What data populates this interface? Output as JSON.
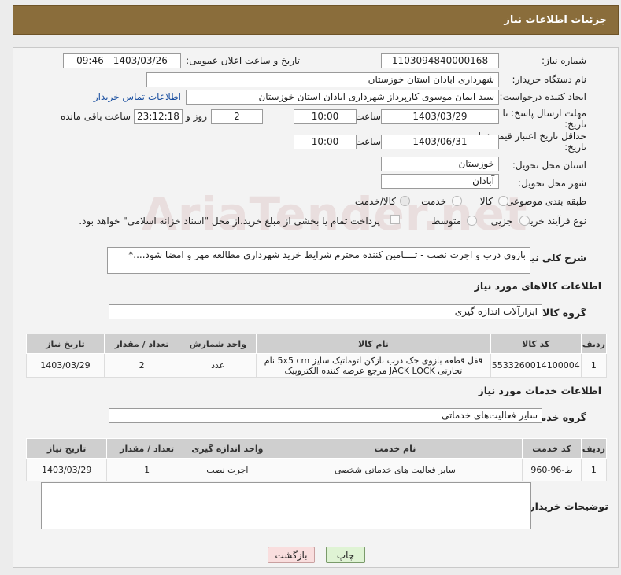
{
  "header": {
    "title": "جزئیات اطلاعات نیاز"
  },
  "form": {
    "need_number_label": "شماره نیاز:",
    "need_number": "1103094840000168",
    "announce_label": "تاریخ و ساعت اعلان عمومی:",
    "announce_value": "1403/03/26 - 09:46",
    "buyer_label": "نام دستگاه خریدار:",
    "buyer_value": "شهرداری ابادان استان خوزستان",
    "creator_label": "ایجاد کننده درخواست:",
    "creator_value": "سید ایمان موسوی کارپرداز شهرداری ابادان استان خوزستان",
    "contact_link": "اطلاعات تماس خریدار",
    "deadline_label": "مهلت ارسال پاسخ: تا تاریخ:",
    "deadline_date": "1403/03/29",
    "time_label": "ساعت",
    "deadline_time": "10:00",
    "days_value": "2",
    "days_label": "روز و",
    "remaining_time": "23:12:18",
    "remaining_label": "ساعت باقی مانده",
    "validity_label": "حداقل تاریخ اعتبار قیمت: تا تاریخ:",
    "validity_date": "1403/06/31",
    "validity_time": "10:00",
    "province_label": "استان محل تحویل:",
    "province_value": "خوزستان",
    "city_label": "شهر محل تحویل:",
    "city_value": "آبادان",
    "category_label": "طبقه بندی موضوعی:",
    "category_options": [
      "کالا",
      "خدمت",
      "کالا/خدمت"
    ],
    "process_label": "نوع فرآیند خرید :",
    "process_options": [
      "جزیی",
      "متوسط"
    ],
    "payment_note": "پرداخت تمام یا بخشی از مبلغ خرید،از محل \"اسناد خزانه اسلامی\" خواهد بود."
  },
  "description": {
    "label": "شرح کلی نیاز:",
    "value": "بازوی درب و اجرت نصب - تــــامین کننده محترم شرایط خرید شهرداری مطالعه مهر و امضا شود....*"
  },
  "goods": {
    "section_title": "اطلاعات کالاهای مورد نیاز",
    "group_label": "گروه کالا:",
    "group_value": "ابزارآلات اندازه گیری",
    "columns": [
      "ردیف",
      "کد کالا",
      "نام کالا",
      "واحد شمارش",
      "تعداد / مقدار",
      "تاریخ نیاز"
    ],
    "rows": [
      {
        "row": "1",
        "code": "5533260014100004",
        "name_line1": "قفل قطعه بازوی جک درب بازکن اتوماتیک سایز 5x5 cm نام",
        "name_line2": "تجارتی JACK LOCK مرجع عرضه کننده الکتروپیک",
        "unit": "عدد",
        "qty": "2",
        "date": "1403/03/29"
      }
    ]
  },
  "services": {
    "section_title": "اطلاعات خدمات مورد نیاز",
    "group_label": "گروه خدمت:",
    "group_value": "سایر فعالیت‌های خدماتی",
    "columns": [
      "ردیف",
      "کد خدمت",
      "نام خدمت",
      "واحد اندازه گیری",
      "تعداد / مقدار",
      "تاریخ نیاز"
    ],
    "rows": [
      {
        "row": "1",
        "code": "ط-96-960",
        "name": "سایر فعالیت های خدماتی شخصی",
        "unit": "اجرت نصب",
        "qty": "1",
        "date": "1403/03/29"
      }
    ]
  },
  "buyer_notes": {
    "label": "توضیحات خریدار:",
    "value": ""
  },
  "buttons": {
    "print": "چاپ",
    "back": "بازگشت"
  },
  "colors": {
    "header_bg": "#8a6d3b",
    "print_btn": "#dff3d4",
    "back_btn": "#f9dede"
  }
}
